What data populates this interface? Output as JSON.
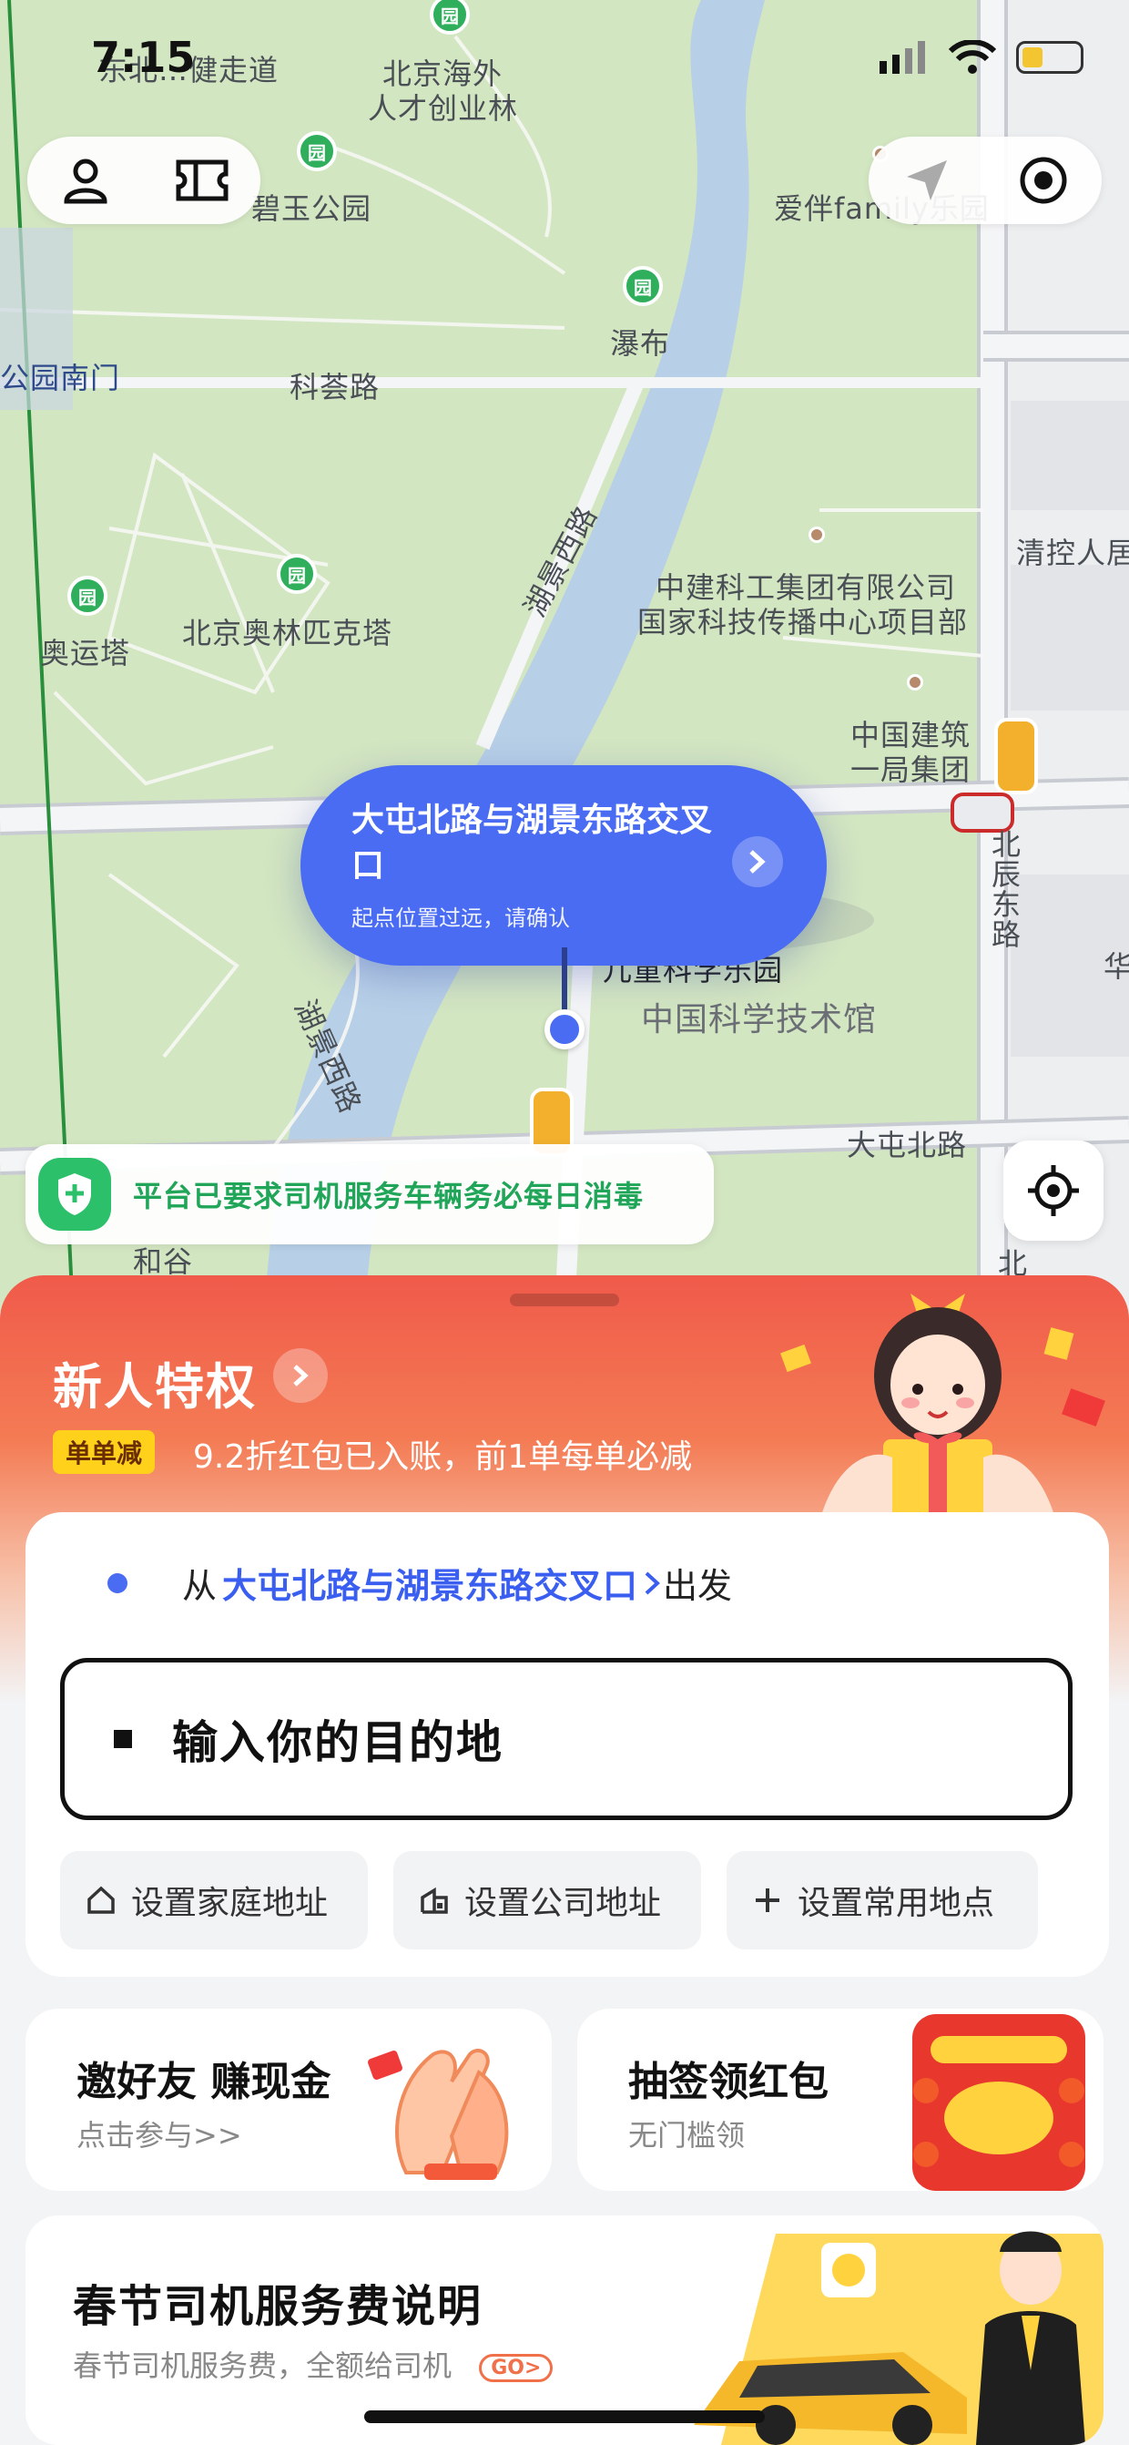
{
  "status": {
    "time": "7:15"
  },
  "map": {
    "labels": {
      "jiandao": "东北…健走道",
      "haiwai": "北京海外",
      "haiwai2": "人才创业林",
      "biyu": "碧玉公园",
      "aibanfamily": "爱伴family乐园",
      "pubu": "瀑布",
      "gongyuannanmen": "公园南门",
      "keshuilu": "科荟路",
      "hujingxilu1": "湖景西路",
      "zhongjian1": "中建科工集团有限公司",
      "zhongjian2": "国家科技传播中心项目部",
      "qingkong": "清控人居",
      "aoyunta": "奥运塔",
      "olympicta": "北京奥林匹克塔",
      "zhongguojianzhu1": "中国建筑",
      "zhongguojianzhu2": "一局集团",
      "beichendonglu": "北辰东路",
      "ertong": "儿童科学乐园",
      "kejiguan": "中国科学技术馆",
      "hujingxilu2": "湖景西路",
      "datunbeilu": "大屯北路",
      "hegu": "和谷",
      "bei": "北",
      "hua": "华"
    },
    "bubble": {
      "title": "大屯北路与湖景东路交叉口",
      "subtitle": "起点位置过远，请确认"
    },
    "notice": "平台已要求司机服务车辆务必每日消毒"
  },
  "promo": {
    "title": "新人特权",
    "badge": "单单减",
    "desc": "9.2折红包已入账，前1单每单必减"
  },
  "trip": {
    "from_prefix": "从",
    "from_location": "大屯北路与湖景东路交叉口",
    "from_suffix": "出发",
    "dest_placeholder": "输入你的目的地",
    "shortcuts": [
      "设置家庭地址",
      "设置公司地址",
      "设置常用地点"
    ]
  },
  "cards": {
    "invite_title": "邀好友 赚现金",
    "invite_sub": "点击参与>>",
    "lottery_title": "抽签领红包",
    "lottery_sub": "无门槛领",
    "festival_title": "春节司机服务费说明",
    "festival_sub": "春节司机服务费，全额给司机",
    "festival_go": "GO>"
  },
  "colors": {
    "accent": "#4a6cf3",
    "promo": "#f05a4a",
    "safe": "#2cc06b"
  }
}
